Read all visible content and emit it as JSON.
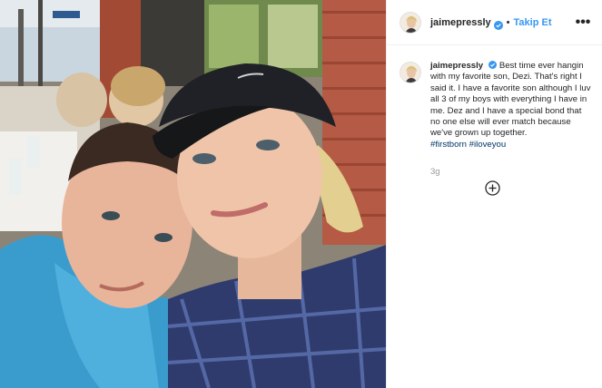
{
  "post": {
    "username": "jaimepressly",
    "follow_label": "Takip Et",
    "more_label": "•••",
    "caption_body": "Best time ever hangin with my favorite son, Dezi. That's right I said it. I have a favorite son although I luv all 3 of my boys with everything I have in me. Dez and I have a special bond that no one else will ever match because we've grown up together.",
    "hashtags": [
      "#firstborn",
      "#iloveyou"
    ],
    "time_ago": "3g"
  },
  "icons": {
    "verified": "verified-badge-icon",
    "more": "more-options-icon",
    "add_comment": "plus-circle-icon"
  },
  "colors": {
    "verified_blue": "#3897f0",
    "follow_blue": "#3897f0",
    "hashtag_blue": "#003569",
    "muted_gray": "#999999"
  }
}
